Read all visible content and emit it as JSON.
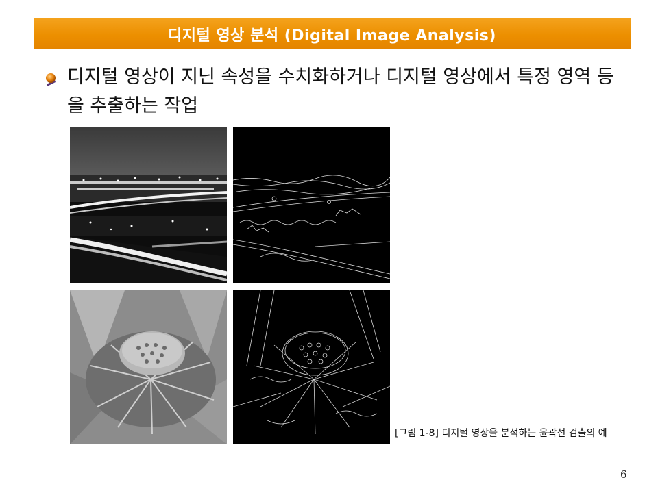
{
  "slide": {
    "title": "디지털 영상 분석 (Digital Image Analysis)",
    "bullet_icon": "orange-ball-bullet-icon",
    "bullet_text": "디지털 영상이 지닌 속성을 수치화하거나 디지털 영상에서 특정 영역 등을 추출하는 작업",
    "figure_caption": "[그림 1-8] 디지털 영상을 분석하는 윤곽선 검출의 예",
    "page_number": "6"
  },
  "colors": {
    "title_bar": "#ec8f00",
    "title_text": "#ffffff",
    "body_text": "#111111"
  }
}
